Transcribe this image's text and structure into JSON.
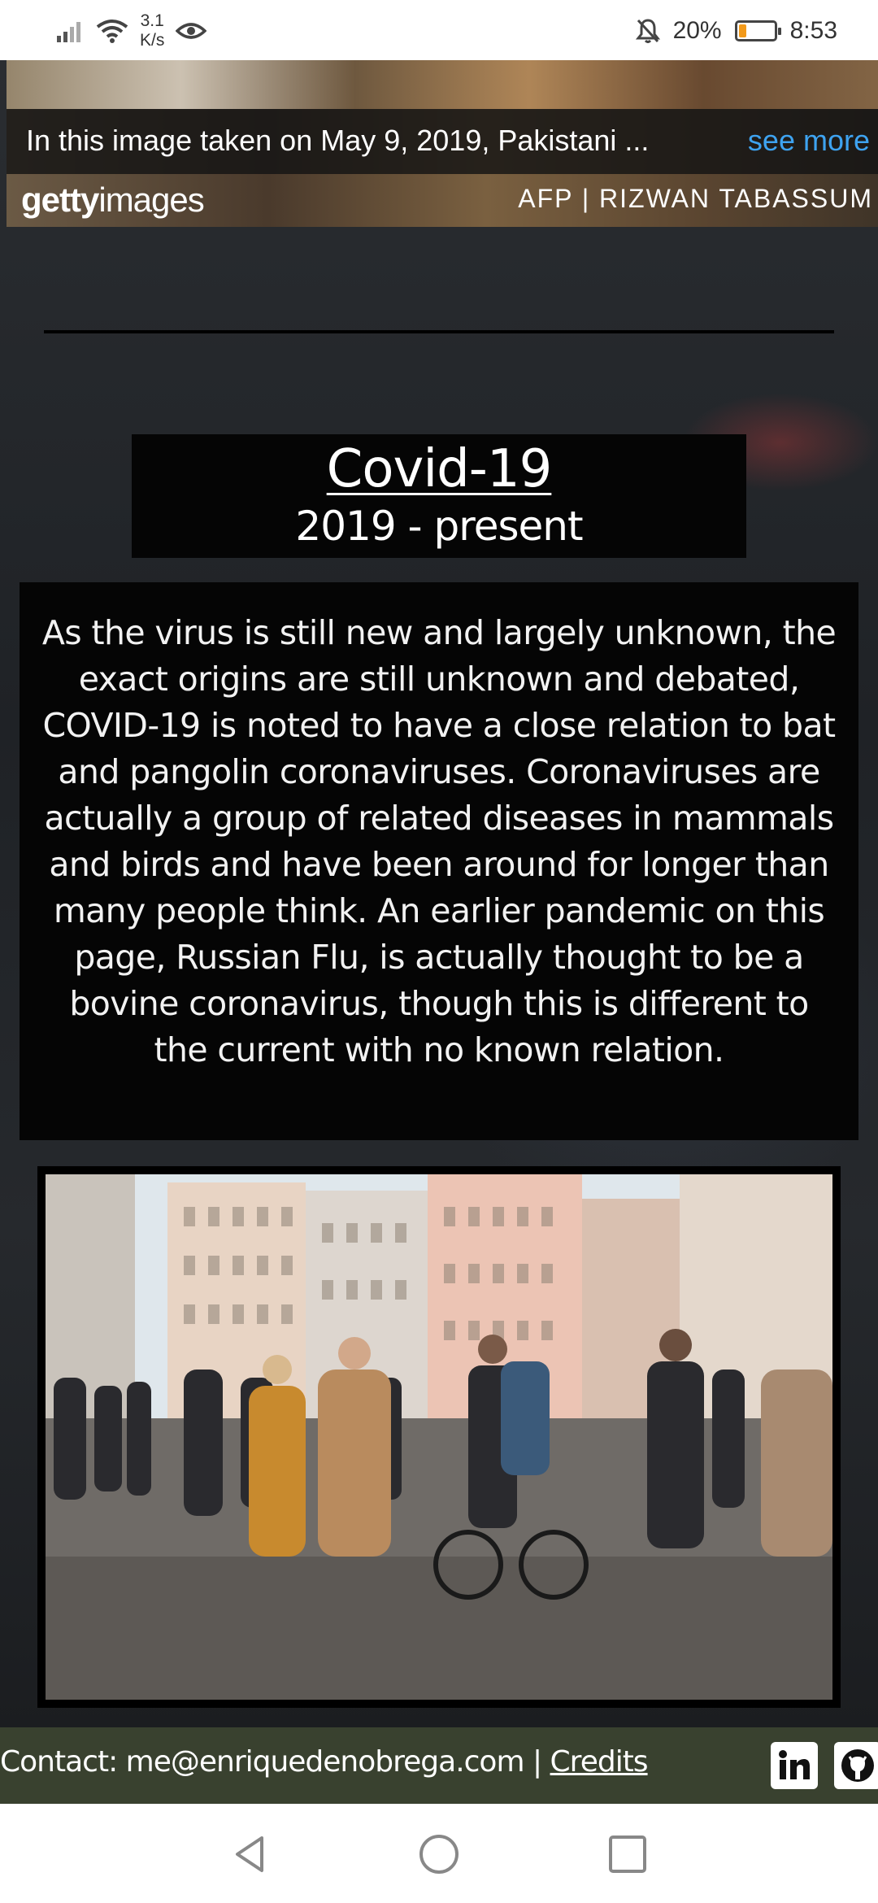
{
  "status_bar": {
    "network_speed_value": "3.1",
    "network_speed_unit": "K/s",
    "battery_percent": "20%",
    "battery_level": 0.2,
    "time": "8:53",
    "battery_color": "#f39a1a"
  },
  "getty_embed": {
    "caption": "In this image taken on May 9, 2019, Pakistani ...",
    "see_more": "see more",
    "logo_bold": "getty",
    "logo_light": "images",
    "credit": "AFP | RIZWAN TABASSUM"
  },
  "section": {
    "title": "Covid-19",
    "subtitle": "2019 - present",
    "body": "As the virus is still new and largely unknown, the exact origins are still unknown and debated, COVID-19 is noted to have a close relation to bat and pangolin coronaviruses. Coronaviruses are actually a group of related diseases in mammals and birds and have been around for longer than many people think. An earlier pandemic on this page, Russian Flu, is actually thought to be a bovine coronavirus, though this is different to the current with no known relation."
  },
  "footer": {
    "contact_text": "Contact: me@enriquedenobrega.com | ",
    "credits_link": "Credits",
    "icons": [
      "linkedin-icon",
      "github-icon"
    ],
    "background": "#39412f"
  },
  "nav_bar": {
    "buttons": [
      "back-icon",
      "home-icon",
      "recents-icon"
    ]
  }
}
